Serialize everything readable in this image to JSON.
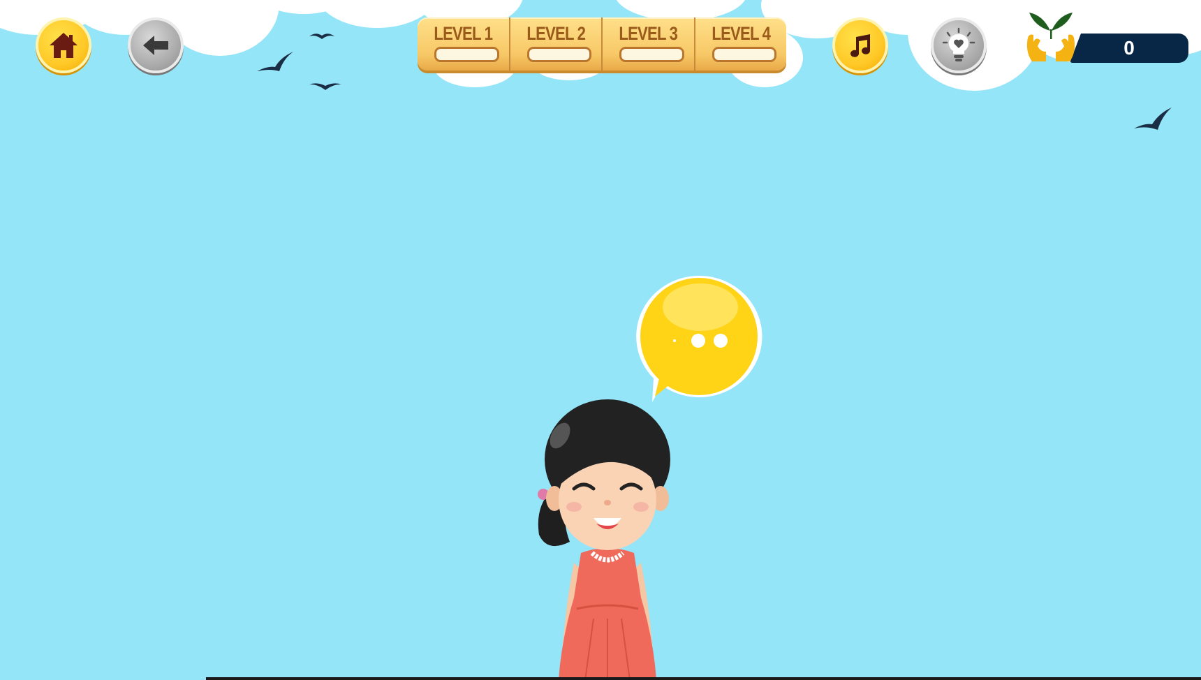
{
  "game": {
    "levels": [
      {
        "label": "LEVEL 1"
      },
      {
        "label": "LEVEL 2"
      },
      {
        "label": "LEVEL 3"
      },
      {
        "label": "LEVEL 4"
      }
    ],
    "score": "0",
    "icons": {
      "home": "home-icon",
      "back": "back-arrow-icon",
      "music": "music-note-icon",
      "hint": "lightbulb-heart-icon",
      "logo": "hands-sprout-logo-icon"
    },
    "colors": {
      "sky": "#95e5f8",
      "button_yellow": "#ffc928",
      "button_grey": "#a8a8a8",
      "levels_bar": "#f7c866",
      "score_bg": "#082645",
      "bubble": "#ffd316",
      "dress": "#ef6a5b"
    }
  }
}
